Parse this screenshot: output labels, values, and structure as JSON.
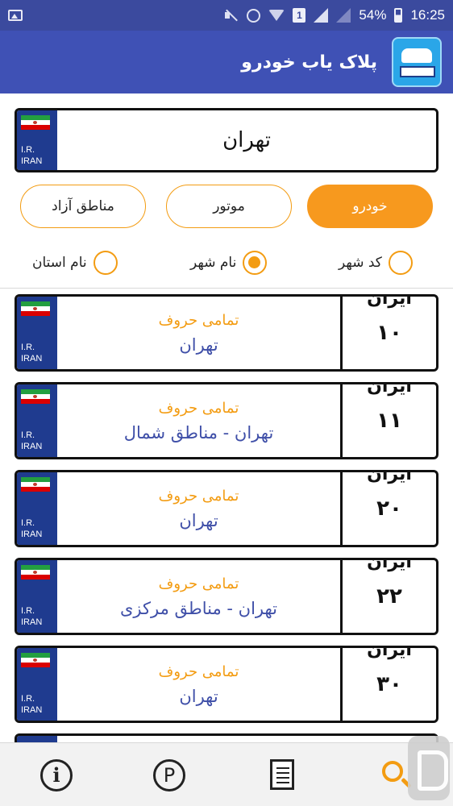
{
  "status_bar": {
    "battery": "54%",
    "time": "16:25",
    "sim_slot": "1"
  },
  "app_bar": {
    "title": "پلاک یاب خودرو"
  },
  "search": {
    "value": "تهران",
    "plate_country_label_1": "I.R.",
    "plate_country_label_2": "IRAN"
  },
  "tabs": [
    {
      "label": "خودرو",
      "active": true
    },
    {
      "label": "موتور",
      "active": false
    },
    {
      "label": "مناطق آزاد",
      "active": false
    }
  ],
  "filters": [
    {
      "label": "کد شهر",
      "checked": false
    },
    {
      "label": "نام شهر",
      "checked": true
    },
    {
      "label": "نام استان",
      "checked": false
    }
  ],
  "plates": [
    {
      "country": "ایران",
      "code": "۱۰",
      "letters": "تمامی حروف",
      "city": "تهران",
      "ir1": "I.R.",
      "ir2": "IRAN"
    },
    {
      "country": "ایران",
      "code": "۱۱",
      "letters": "تمامی حروف",
      "city": "تهران - مناطق شمال",
      "ir1": "I.R.",
      "ir2": "IRAN"
    },
    {
      "country": "ایران",
      "code": "۲۰",
      "letters": "تمامی حروف",
      "city": "تهران",
      "ir1": "I.R.",
      "ir2": "IRAN"
    },
    {
      "country": "ایران",
      "code": "۲۲",
      "letters": "تمامی حروف",
      "city": "تهران - مناطق مرکزی",
      "ir1": "I.R.",
      "ir2": "IRAN"
    },
    {
      "country": "ایران",
      "code": "۳۰",
      "letters": "تمامی حروف",
      "city": "تهران",
      "ir1": "I.R.",
      "ir2": "IRAN"
    }
  ],
  "bottom_nav": {
    "info_glyph": "i",
    "parking_glyph": "P",
    "items": [
      "info-icon",
      "parking-icon",
      "document-icon",
      "search-icon"
    ]
  },
  "colors": {
    "primary": "#3f51b5",
    "accent": "#f7991e",
    "plate_blue": "#1f3b8f",
    "city_text": "#3f4fa8"
  }
}
